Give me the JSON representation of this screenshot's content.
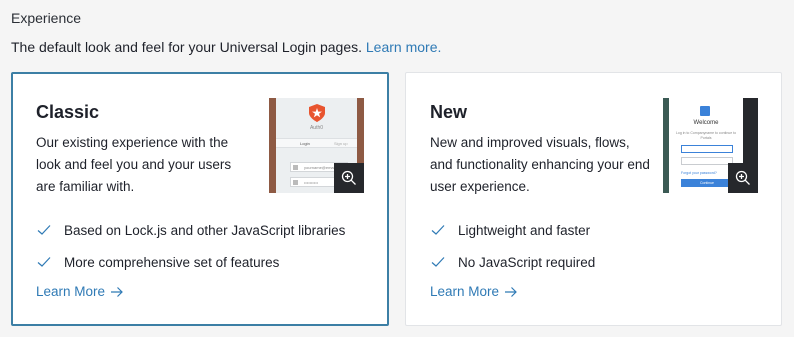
{
  "section": {
    "title": "Experience",
    "description": "The default look and feel for your Universal Login pages.",
    "learn_more_link": "Learn more."
  },
  "cards": {
    "classic": {
      "title": "Classic",
      "description": "Our existing experience with the look and feel you and your users are familiar with.",
      "features": [
        "Based on Lock.js and other JavaScript libraries",
        "More comprehensive set of features"
      ],
      "learn_more": "Learn More",
      "selected": true,
      "thumbnail": {
        "brand": "Auth0",
        "tab_login": "Login",
        "tab_signup": "Sign up",
        "email": "yourname@email.com",
        "password": "••••••••••"
      }
    },
    "new": {
      "title": "New",
      "description": "New and improved visuals, flows, and functionality enhancing your end user experience.",
      "features": [
        "Lightweight and faster",
        "No JavaScript required"
      ],
      "learn_more": "Learn More",
      "selected": false,
      "thumbnail": {
        "welcome": "Welcome",
        "subtitle": "Log in to Companyname to continue to Portals",
        "forgot": "Forgot your password?",
        "button": "Continue"
      }
    }
  },
  "icons": {
    "check": "check-icon",
    "arrow": "arrow-right-icon",
    "zoom": "zoom-in-icon"
  },
  "colors": {
    "accent": "#2f7ab5",
    "selected_border": "#3c7fa5",
    "background": "#f5f5f5"
  }
}
